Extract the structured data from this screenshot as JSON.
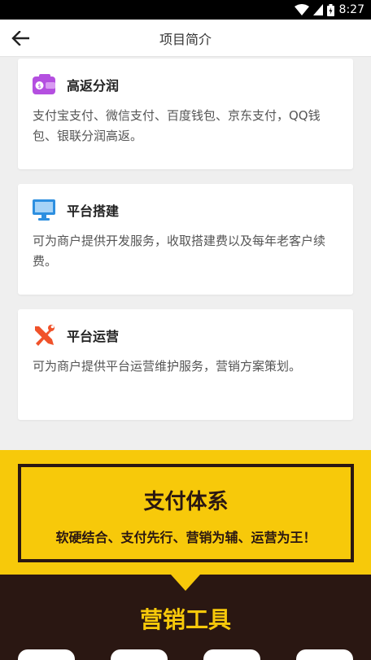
{
  "status_bar": {
    "time": "8:27",
    "icons": [
      "wifi-icon",
      "signal-icon",
      "battery-icon"
    ]
  },
  "header": {
    "title": "项目简介",
    "back_icon": "back-arrow-icon"
  },
  "cards": [
    {
      "icon": "wallet-icon",
      "icon_color": "#b44fe0",
      "title": "高返分润",
      "description": "支付宝支付、微信支付、百度钱包、京东支付，QQ钱包、银联分润高返。"
    },
    {
      "icon": "monitor-icon",
      "icon_color": "#2d8fe0",
      "title": "平台搭建",
      "description": "可为商户提供开发服务，收取搭建费以及每年老客户续费。"
    },
    {
      "icon": "tools-icon",
      "icon_color": "#f0522a",
      "title": "平台运营",
      "description": "可为商户提供平台运营维护服务，营销方案策划。"
    }
  ],
  "payment_section": {
    "title": "支付体系",
    "slogan": "软硬结合、支付先行、营销为辅、运营为王！",
    "bg_color": "#f7c90a"
  },
  "tools_section": {
    "title": "营销工具",
    "bg_color": "#2a1712"
  }
}
